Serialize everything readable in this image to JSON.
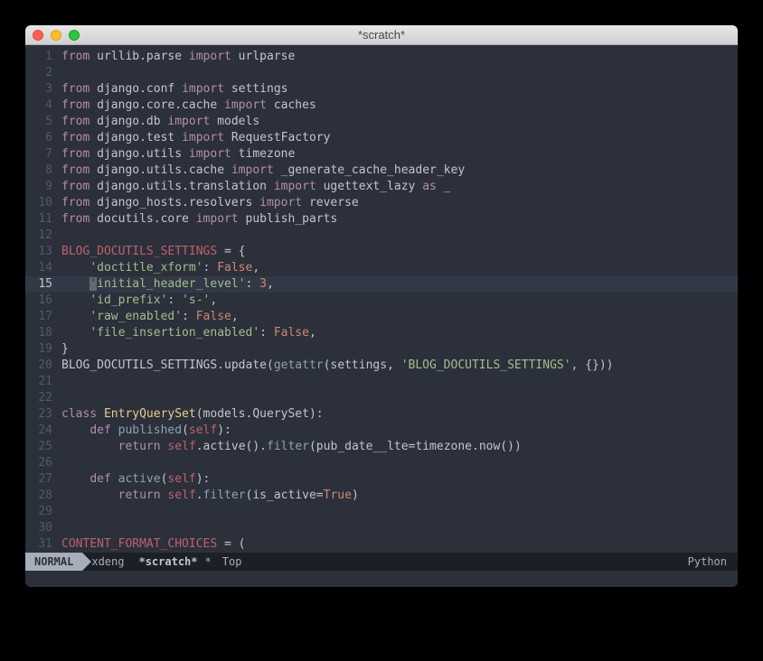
{
  "window": {
    "title": "*scratch*"
  },
  "modeline": {
    "mode": "NORMAL",
    "user": "xdeng",
    "buffer": "*scratch*",
    "modified": "*",
    "position": "Top",
    "major_mode": "Python"
  },
  "cursor": {
    "line": 15,
    "col": 5
  },
  "lines": [
    {
      "n": 1,
      "tokens": [
        [
          "kw",
          "from"
        ],
        [
          "ident",
          " urllib.parse "
        ],
        [
          "kw",
          "import"
        ],
        [
          "ident",
          " urlparse"
        ]
      ]
    },
    {
      "n": 2,
      "tokens": []
    },
    {
      "n": 3,
      "tokens": [
        [
          "kw",
          "from"
        ],
        [
          "ident",
          " django.conf "
        ],
        [
          "kw",
          "import"
        ],
        [
          "ident",
          " settings"
        ]
      ]
    },
    {
      "n": 4,
      "tokens": [
        [
          "kw",
          "from"
        ],
        [
          "ident",
          " django.core.cache "
        ],
        [
          "kw",
          "import"
        ],
        [
          "ident",
          " caches"
        ]
      ]
    },
    {
      "n": 5,
      "tokens": [
        [
          "kw",
          "from"
        ],
        [
          "ident",
          " django.db "
        ],
        [
          "kw",
          "import"
        ],
        [
          "ident",
          " models"
        ]
      ]
    },
    {
      "n": 6,
      "tokens": [
        [
          "kw",
          "from"
        ],
        [
          "ident",
          " django.test "
        ],
        [
          "kw",
          "import"
        ],
        [
          "ident",
          " RequestFactory"
        ]
      ]
    },
    {
      "n": 7,
      "tokens": [
        [
          "kw",
          "from"
        ],
        [
          "ident",
          " django.utils "
        ],
        [
          "kw",
          "import"
        ],
        [
          "ident",
          " timezone"
        ]
      ]
    },
    {
      "n": 8,
      "tokens": [
        [
          "kw",
          "from"
        ],
        [
          "ident",
          " django.utils.cache "
        ],
        [
          "kw",
          "import"
        ],
        [
          "ident",
          " _generate_cache_header_key"
        ]
      ]
    },
    {
      "n": 9,
      "tokens": [
        [
          "kw",
          "from"
        ],
        [
          "ident",
          " django.utils.translation "
        ],
        [
          "kw",
          "import"
        ],
        [
          "ident",
          " ugettext_lazy "
        ],
        [
          "kw",
          "as"
        ],
        [
          "ident",
          " _"
        ]
      ]
    },
    {
      "n": 10,
      "tokens": [
        [
          "kw",
          "from"
        ],
        [
          "ident",
          " django_hosts.resolvers "
        ],
        [
          "kw",
          "import"
        ],
        [
          "ident",
          " reverse"
        ]
      ]
    },
    {
      "n": 11,
      "tokens": [
        [
          "kw",
          "from"
        ],
        [
          "ident",
          " docutils.core "
        ],
        [
          "kw",
          "import"
        ],
        [
          "ident",
          " publish_parts"
        ]
      ]
    },
    {
      "n": 12,
      "tokens": []
    },
    {
      "n": 13,
      "tokens": [
        [
          "err",
          "BLOG_DOCUTILS_SETTINGS"
        ],
        [
          "ident",
          " = {"
        ]
      ]
    },
    {
      "n": 14,
      "tokens": [
        [
          "ident",
          "    "
        ],
        [
          "str",
          "'doctitle_xform'"
        ],
        [
          "ident",
          ": "
        ],
        [
          "bool",
          "False"
        ],
        [
          "ident",
          ","
        ]
      ]
    },
    {
      "n": 15,
      "tokens": [
        [
          "ident",
          "    "
        ],
        [
          "cursor",
          "'"
        ],
        [
          "str",
          "initial_header_level'"
        ],
        [
          "ident",
          ": "
        ],
        [
          "num",
          "3"
        ],
        [
          "ident",
          ","
        ]
      ]
    },
    {
      "n": 16,
      "tokens": [
        [
          "ident",
          "    "
        ],
        [
          "str",
          "'id_prefix'"
        ],
        [
          "ident",
          ": "
        ],
        [
          "str",
          "'s-'"
        ],
        [
          "ident",
          ","
        ]
      ]
    },
    {
      "n": 17,
      "tokens": [
        [
          "ident",
          "    "
        ],
        [
          "str",
          "'raw_enabled'"
        ],
        [
          "ident",
          ": "
        ],
        [
          "bool",
          "False"
        ],
        [
          "ident",
          ","
        ]
      ]
    },
    {
      "n": 18,
      "tokens": [
        [
          "ident",
          "    "
        ],
        [
          "str",
          "'file_insertion_enabled'"
        ],
        [
          "ident",
          ": "
        ],
        [
          "bool",
          "False"
        ],
        [
          "ident",
          ","
        ]
      ]
    },
    {
      "n": 19,
      "tokens": [
        [
          "ident",
          "}"
        ]
      ]
    },
    {
      "n": 20,
      "tokens": [
        [
          "ident",
          "BLOG_DOCUTILS_SETTINGS.update("
        ],
        [
          "fn",
          "getattr"
        ],
        [
          "ident",
          "(settings, "
        ],
        [
          "str",
          "'BLOG_DOCUTILS_SETTINGS'"
        ],
        [
          "ident",
          ", {}))"
        ]
      ]
    },
    {
      "n": 21,
      "tokens": []
    },
    {
      "n": 22,
      "tokens": []
    },
    {
      "n": 23,
      "tokens": [
        [
          "kw",
          "class"
        ],
        [
          "ident",
          " "
        ],
        [
          "cls",
          "EntryQuerySet"
        ],
        [
          "ident",
          "(models.QuerySet):"
        ]
      ]
    },
    {
      "n": 24,
      "tokens": [
        [
          "ident",
          "    "
        ],
        [
          "kw",
          "def"
        ],
        [
          "ident",
          " "
        ],
        [
          "fn",
          "published"
        ],
        [
          "ident",
          "("
        ],
        [
          "self",
          "self"
        ],
        [
          "ident",
          "):"
        ]
      ]
    },
    {
      "n": 25,
      "tokens": [
        [
          "ident",
          "        "
        ],
        [
          "kw",
          "return"
        ],
        [
          "ident",
          " "
        ],
        [
          "self",
          "self"
        ],
        [
          "ident",
          ".active()."
        ],
        [
          "fn",
          "filter"
        ],
        [
          "ident",
          "(pub_date__lte=timezone.now())"
        ]
      ]
    },
    {
      "n": 26,
      "tokens": []
    },
    {
      "n": 27,
      "tokens": [
        [
          "ident",
          "    "
        ],
        [
          "kw",
          "def"
        ],
        [
          "ident",
          " "
        ],
        [
          "fn",
          "active"
        ],
        [
          "ident",
          "("
        ],
        [
          "self",
          "self"
        ],
        [
          "ident",
          "):"
        ]
      ]
    },
    {
      "n": 28,
      "tokens": [
        [
          "ident",
          "        "
        ],
        [
          "kw",
          "return"
        ],
        [
          "ident",
          " "
        ],
        [
          "self",
          "self"
        ],
        [
          "ident",
          "."
        ],
        [
          "fn",
          "filter"
        ],
        [
          "ident",
          "(is_active="
        ],
        [
          "bool",
          "True"
        ],
        [
          "ident",
          ")"
        ]
      ]
    },
    {
      "n": 29,
      "tokens": []
    },
    {
      "n": 30,
      "tokens": []
    },
    {
      "n": 31,
      "tokens": [
        [
          "err",
          "CONTENT_FORMAT_CHOICES"
        ],
        [
          "ident",
          " = ("
        ]
      ]
    }
  ]
}
